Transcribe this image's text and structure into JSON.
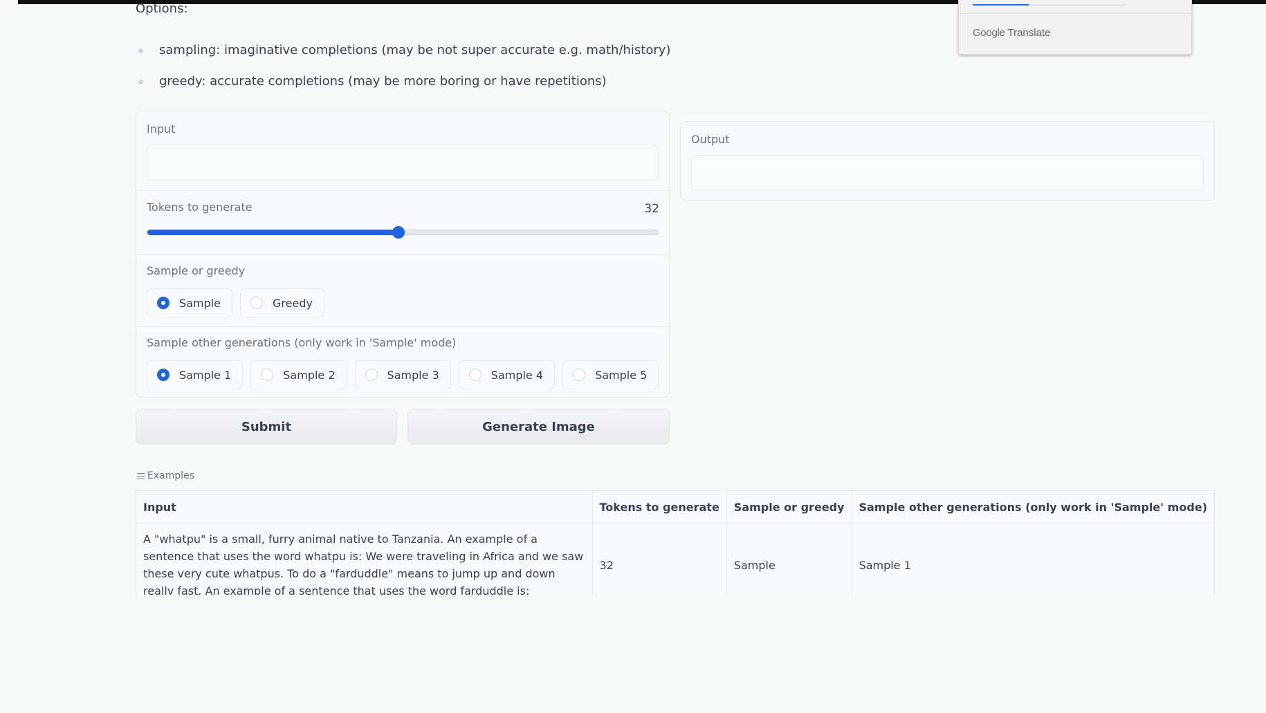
{
  "options": {
    "title": "Options:",
    "items": [
      "sampling: imaginative completions (may be not super accurate e.g. math/history)",
      "greedy: accurate completions (may be more boring or have repetitions)"
    ]
  },
  "input_panel": {
    "input_label": "Input",
    "input_value": "",
    "tokens_label": "Tokens to generate",
    "tokens_value": "32",
    "tokens_fill_fraction": 0.492,
    "mode_label": "Sample or greedy",
    "mode_options": [
      "Sample",
      "Greedy"
    ],
    "mode_selected": "Sample",
    "gen_label": "Sample other generations (only work in 'Sample' mode)",
    "gen_options": [
      "Sample 1",
      "Sample 2",
      "Sample 3",
      "Sample 4",
      "Sample 5"
    ],
    "gen_selected": "Sample 1"
  },
  "output_panel": {
    "output_label": "Output",
    "output_value": ""
  },
  "buttons": {
    "submit": "Submit",
    "generate_image": "Generate Image"
  },
  "examples": {
    "header": "Examples",
    "columns": [
      "Input",
      "Tokens to generate",
      "Sample or greedy",
      "Sample other generations (only work in 'Sample' mode)"
    ],
    "rows": [
      {
        "input": "A \"whatpu\" is a small, furry animal native to Tanzania. An example of a sentence that uses the word whatpu is: We were traveling in Africa and we saw these very cute whatpus. To do a \"farduddle\" means to jump up and down really fast. An example of a sentence that uses the word farduddle is:",
        "tokens": "32",
        "mode": "Sample",
        "generation": "Sample 1"
      }
    ]
  },
  "google_translate": {
    "brand_google": "Google",
    "brand_translate": "Translate"
  },
  "colors": {
    "accent": "#1f63e6",
    "background": "#f8f9f9"
  }
}
